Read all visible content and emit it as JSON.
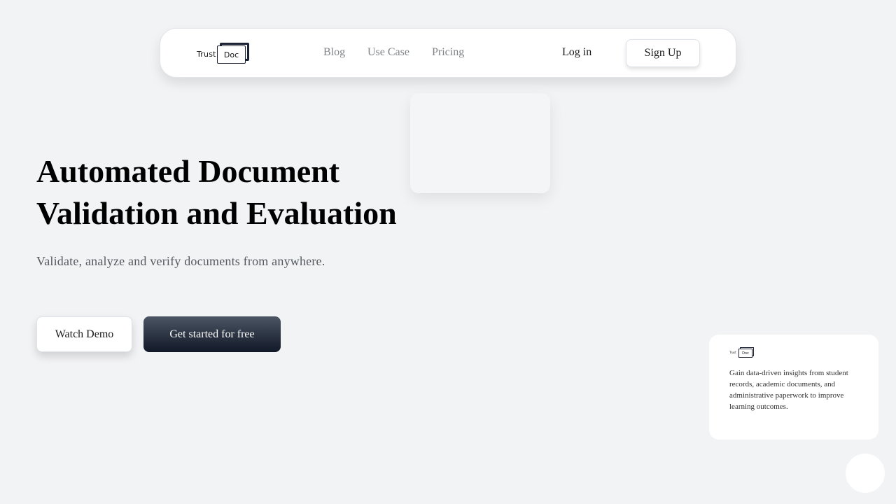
{
  "nav": {
    "logo_text": "Trust",
    "logo_box_text": "Doc",
    "links": [
      "Blog",
      "Use Case",
      "Pricing"
    ],
    "login_label": "Log in",
    "signup_label": "Sign Up"
  },
  "hero": {
    "title": "Automated Document Validation and Evaluation",
    "subtitle": "Validate, analyze and verify documents from anywhere.",
    "watch_demo_label": "Watch Demo",
    "get_started_label": "Get started for free"
  },
  "info_card": {
    "logo_text": "Trust",
    "logo_box_text": "Doc",
    "text": "Gain data-driven insights from student records, academic documents, and administrative paperwork to improve learning outcomes."
  },
  "colors": {
    "background": "#f2f3f5",
    "primary_button_top": "#4b5563",
    "primary_button_bottom": "#111827",
    "nav_link": "#808387"
  }
}
